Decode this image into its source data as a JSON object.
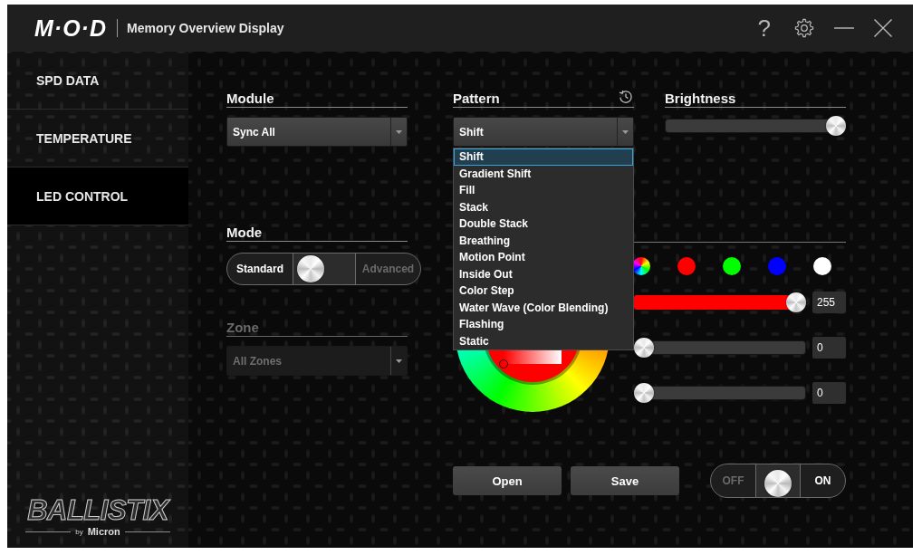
{
  "window": {
    "logo": "M·O·D",
    "title": "Memory Overview Display",
    "buttons": [
      {
        "kind": "help",
        "label": "?"
      },
      {
        "kind": "settings"
      },
      {
        "kind": "minimize"
      },
      {
        "kind": "close"
      }
    ]
  },
  "sidebar": {
    "items": [
      {
        "label": "SPD DATA",
        "selected": false
      },
      {
        "label": "TEMPERATURE",
        "selected": false
      },
      {
        "label": "LED CONTROL",
        "selected": true
      }
    ],
    "brand": {
      "name": "BALLISTIX",
      "by": "by",
      "maker": "Micron"
    }
  },
  "module": {
    "label": "Module",
    "value": "Sync All"
  },
  "pattern": {
    "label": "Pattern",
    "value": "Shift",
    "expanded": true,
    "options": [
      {
        "label": "Shift",
        "selected": true
      },
      {
        "label": "Gradient Shift",
        "selected": false
      },
      {
        "label": "Fill",
        "selected": false
      },
      {
        "label": "Stack",
        "selected": false
      },
      {
        "label": "Double Stack",
        "selected": false
      },
      {
        "label": "Breathing",
        "selected": false
      },
      {
        "label": "Motion Point",
        "selected": false
      },
      {
        "label": "Inside Out",
        "selected": false
      },
      {
        "label": "Color Step",
        "selected": false
      },
      {
        "label": "Water Wave (Color Blending)",
        "selected": false
      },
      {
        "label": "Flashing",
        "selected": false
      },
      {
        "label": "Static",
        "selected": false
      }
    ]
  },
  "brightness": {
    "label": "Brightness",
    "level": 1
  },
  "mode": {
    "label": "Mode",
    "options": [
      {
        "label": "Standard",
        "selected": true
      },
      {
        "label": "Advanced",
        "selected": false
      }
    ]
  },
  "zone": {
    "label": "Zone",
    "value": "All Zones",
    "disabled": true
  },
  "color": {
    "presets": [
      {
        "kind": "spectrum"
      },
      {
        "kind": "solid",
        "color": "#ff0000"
      },
      {
        "kind": "solid",
        "color": "#00ff00"
      },
      {
        "kind": "solid",
        "color": "#0000ff"
      },
      {
        "kind": "solid",
        "color": "#ffffff"
      }
    ],
    "channels": [
      {
        "color": "#ff0000",
        "level": 1,
        "value": "255"
      },
      {
        "level": 0,
        "value": "0"
      },
      {
        "level": 0,
        "value": "0"
      }
    ]
  },
  "actions": [
    {
      "label": "Open"
    },
    {
      "label": "Save"
    }
  ],
  "power": {
    "options": [
      {
        "label": "OFF",
        "selected": false
      },
      {
        "label": "ON",
        "selected": true
      }
    ]
  }
}
